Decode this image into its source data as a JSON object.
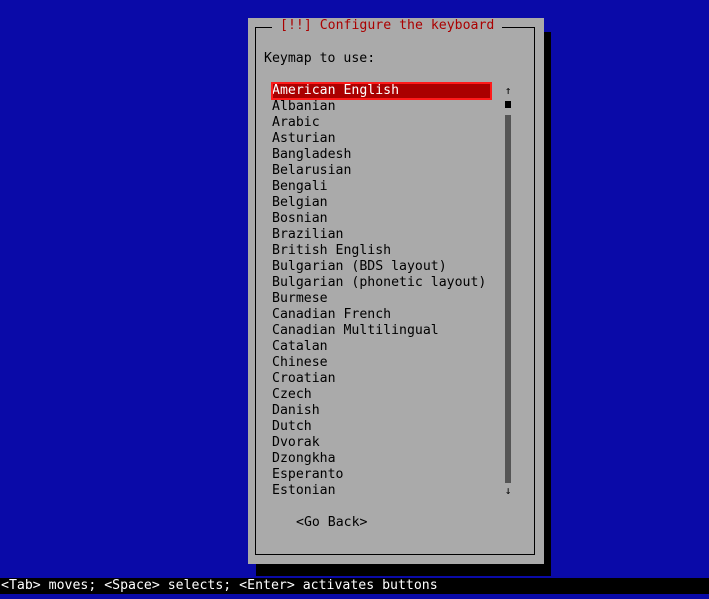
{
  "dialog": {
    "title": "[!!] Configure the keyboard",
    "prompt": "Keymap to use:",
    "go_back_label": "<Go Back>"
  },
  "keymaps": {
    "selected_index": 0,
    "items": [
      "American English",
      "Albanian",
      "Arabic",
      "Asturian",
      "Bangladesh",
      "Belarusian",
      "Bengali",
      "Belgian",
      "Bosnian",
      "Brazilian",
      "British English",
      "Bulgarian (BDS layout)",
      "Bulgarian (phonetic layout)",
      "Burmese",
      "Canadian French",
      "Canadian Multilingual",
      "Catalan",
      "Chinese",
      "Croatian",
      "Czech",
      "Danish",
      "Dutch",
      "Dvorak",
      "Dzongkha",
      "Esperanto",
      "Estonian"
    ]
  },
  "scrollbar": {
    "up_icon": "↑",
    "down_icon": "↓"
  },
  "statusbar": {
    "text": "<Tab> moves; <Space> selects; <Enter> activates buttons"
  },
  "colors": {
    "background": "#0a0aa8",
    "dialog": "#aaaaaa",
    "title": "#aa0000",
    "selection": "#aa0000",
    "selection_border": "#ff1a1a"
  }
}
